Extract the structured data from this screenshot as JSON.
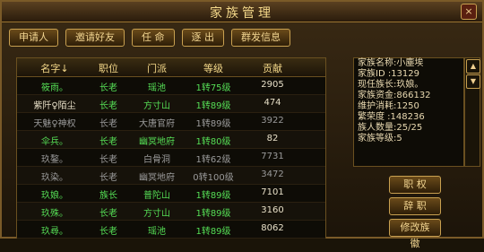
{
  "window": {
    "title": "家族管理",
    "close": "×"
  },
  "toolbar": [
    {
      "label": "申请人"
    },
    {
      "label": "邀请好友"
    },
    {
      "label": "任 命"
    },
    {
      "label": "逐 出"
    },
    {
      "label": "群发信息"
    }
  ],
  "table": {
    "headers": [
      "名字↓",
      "职位",
      "门派",
      "等级",
      "贡献"
    ],
    "rows": [
      {
        "name": "筱雨。",
        "pos": "长老",
        "sect": "瑶池",
        "lvl": "1转75级",
        "con": "2905",
        "nameColor": "#55dd55"
      },
      {
        "name": "紫阡♀陌尘",
        "pos": "长老",
        "sect": "方寸山",
        "lvl": "1转89级",
        "con": "474",
        "nameColor": "#e8e0c8"
      },
      {
        "name": "天魅♀神权",
        "pos": "长老",
        "sect": "大唐官府",
        "lvl": "1转89级",
        "con": "3922",
        "nameColor": "#9a9a9a"
      },
      {
        "name": "伞兵。",
        "pos": "长老",
        "sect": "幽冥地府",
        "lvl": "1转80级",
        "con": "82",
        "nameColor": "#55dd55"
      },
      {
        "name": "玖鏊。",
        "pos": "长老",
        "sect": "白骨洞",
        "lvl": "1转62级",
        "con": "7731",
        "nameColor": "#9a9a9a"
      },
      {
        "name": "玖染。",
        "pos": "长老",
        "sect": "幽冥地府",
        "lvl": "0转100级",
        "con": "3472",
        "nameColor": "#9a9a9a"
      },
      {
        "name": "玖娘。",
        "pos": "族长",
        "sect": "普陀山",
        "lvl": "1转89级",
        "con": "7101",
        "nameColor": "#55dd55"
      },
      {
        "name": "玖殊。",
        "pos": "长老",
        "sect": "方寸山",
        "lvl": "1转89级",
        "con": "3160",
        "nameColor": "#55dd55"
      },
      {
        "name": "玖尋。",
        "pos": "长老",
        "sect": "瑶池",
        "lvl": "1转89级",
        "con": "8062",
        "nameColor": "#55dd55"
      }
    ]
  },
  "info": {
    "lines": [
      "家族名称:小塵埃",
      "家族ID  :13129",
      "现任族长:玖娘。",
      "家族资金:866132",
      "维护消耗:1250",
      "繁荣度  :148236",
      "族人数量:25/25",
      "家族等级:5"
    ],
    "scroll_up": "▲",
    "scroll_down": "▼"
  },
  "actions": [
    {
      "label": "职 权"
    },
    {
      "label": "辞 职"
    },
    {
      "label": "修改族徽"
    }
  ],
  "colors": {
    "accent": "#f5d98a",
    "green": "#55dd55",
    "grey": "#9a9a9a"
  }
}
